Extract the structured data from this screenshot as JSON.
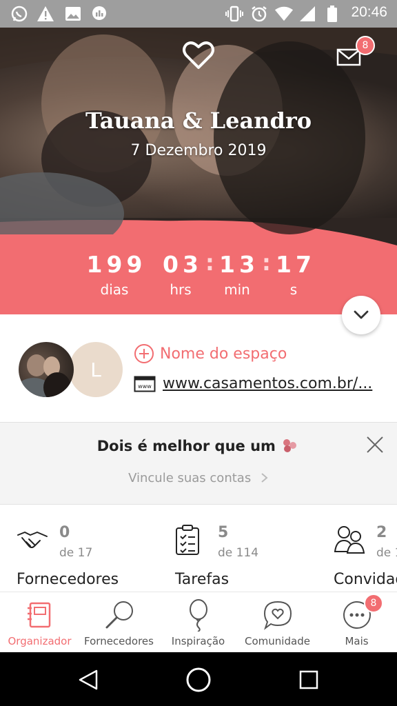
{
  "status_bar": {
    "time": "20:46",
    "left_icons": [
      "whatsapp-icon",
      "warning-icon",
      "image-icon",
      "stats-icon"
    ],
    "right_icons": [
      "vibrate-icon",
      "alarm-icon",
      "wifi-icon",
      "signal-icon",
      "battery-icon"
    ]
  },
  "hero": {
    "couple_names": "Tauana & Leandro",
    "wedding_date": "7 Dezembro 2019",
    "mail_badge": "8"
  },
  "countdown": {
    "days": "199",
    "hours": "03",
    "minutes": "13",
    "seconds": "17",
    "days_label": "dias",
    "hours_label": "hrs",
    "minutes_label": "min",
    "seconds_label": "s",
    "separator": ":"
  },
  "profile": {
    "partner_initial": "L",
    "venue_label": "Nome do espaço",
    "website": "www.casamentos.com.br/..."
  },
  "banner": {
    "title": "Dois é melhor que um",
    "link": "Vincule suas contas"
  },
  "stats": [
    {
      "count": "0",
      "of": "de 17",
      "label": "Fornecedores",
      "icon": "handshake-icon"
    },
    {
      "count": "5",
      "of": "de 114",
      "label": "Tarefas",
      "icon": "checklist-icon"
    },
    {
      "count": "2",
      "of": "de 1",
      "label": "Convidad",
      "icon": "guests-icon"
    }
  ],
  "bottom_nav": {
    "items": [
      {
        "label": "Organizador",
        "icon": "notebook-icon",
        "active": true
      },
      {
        "label": "Fornecedores",
        "icon": "search-icon"
      },
      {
        "label": "Inspiração",
        "icon": "balloon-icon"
      },
      {
        "label": "Comunidade",
        "icon": "chat-heart-icon"
      },
      {
        "label": "Mais",
        "icon": "more-icon",
        "badge": "8"
      }
    ]
  },
  "colors": {
    "accent": "#f26d71",
    "status_bar": "#9e9e9e",
    "banner_bg": "#f4f4f4"
  }
}
